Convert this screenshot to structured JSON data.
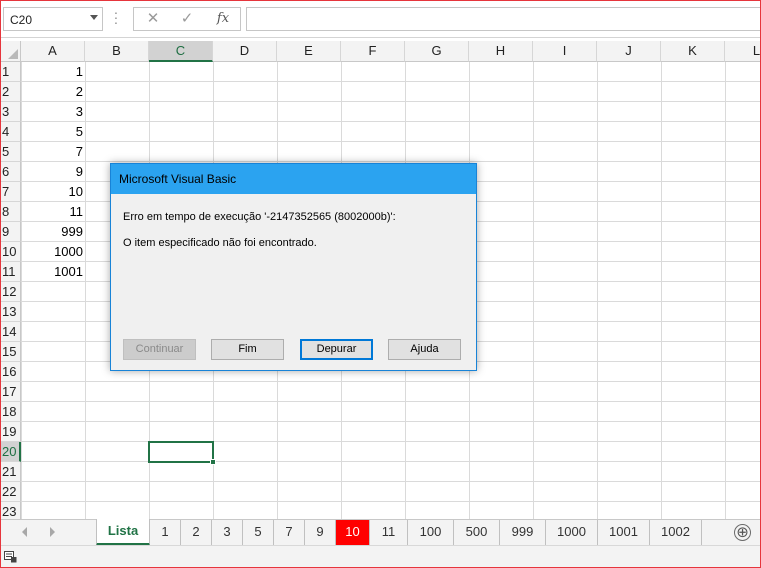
{
  "formula_bar": {
    "name_box": "C20",
    "cancel_icon": "✕",
    "enter_icon": "✓",
    "fx_label": "fx",
    "formula": ""
  },
  "columns": [
    "A",
    "B",
    "C",
    "D",
    "E",
    "F",
    "G",
    "H",
    "I",
    "J",
    "K",
    "L"
  ],
  "rows": [
    "1",
    "2",
    "3",
    "4",
    "5",
    "6",
    "7",
    "8",
    "9",
    "10",
    "11",
    "12",
    "13",
    "14",
    "15",
    "16",
    "17",
    "18",
    "19",
    "20",
    "21",
    "22",
    "23"
  ],
  "column_a_values": [
    "1",
    "2",
    "3",
    "5",
    "7",
    "9",
    "10",
    "11",
    "999",
    "1000",
    "1001"
  ],
  "selected_cell": "C20",
  "sheet_tabs": [
    {
      "label": "Lista",
      "active": true
    },
    {
      "label": "1"
    },
    {
      "label": "2"
    },
    {
      "label": "3"
    },
    {
      "label": "5"
    },
    {
      "label": "7"
    },
    {
      "label": "9"
    },
    {
      "label": "10",
      "highlight": "#ff0000"
    },
    {
      "label": "11"
    },
    {
      "label": "100"
    },
    {
      "label": "500"
    },
    {
      "label": "999"
    },
    {
      "label": "1000"
    },
    {
      "label": "1001"
    },
    {
      "label": "1002"
    }
  ],
  "add_sheet_icon": "⊕",
  "dialog": {
    "title": "Microsoft Visual Basic",
    "message_line1": "Erro em tempo de execução '-2147352565 (8002000b)':",
    "message_line2": "O item especificado não foi encontrado.",
    "buttons": {
      "continuar": "Continuar",
      "fim": "Fim",
      "depurar": "Depurar",
      "ajuda": "Ajuda"
    }
  },
  "colors": {
    "excel_green": "#217346",
    "dialog_title_bar": "#2ba3f0",
    "highlighted_tab": "#ff0000",
    "default_button_border": "#0078d7"
  }
}
